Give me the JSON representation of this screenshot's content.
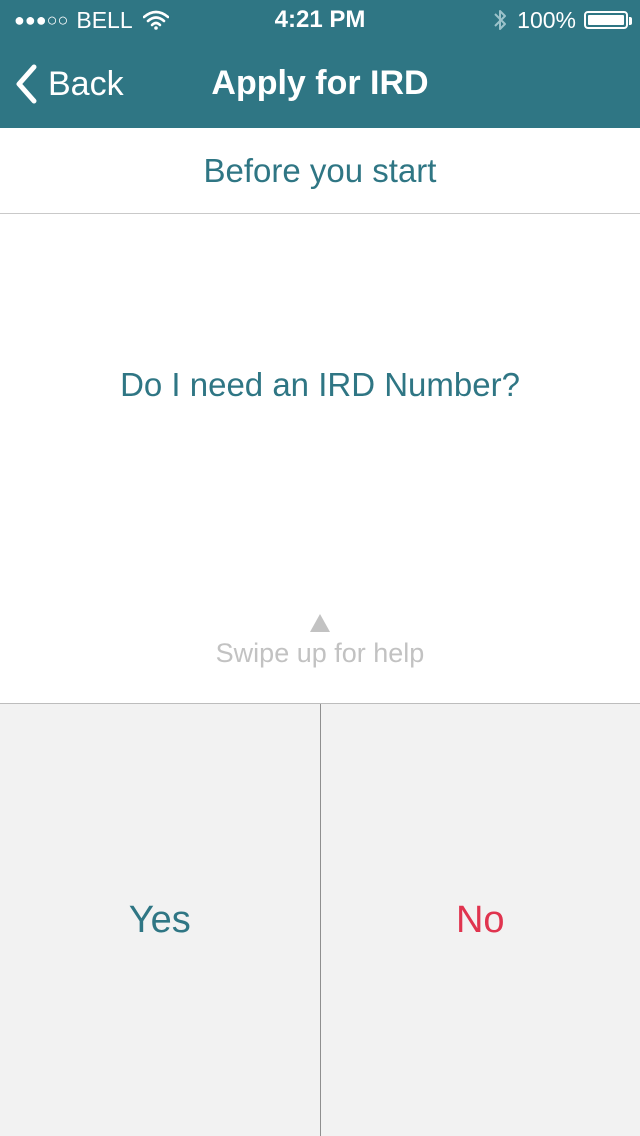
{
  "status_bar": {
    "signal": "●●●○○",
    "carrier": "BELL",
    "time": "4:21 PM",
    "battery_percent": "100%"
  },
  "nav": {
    "back_label": "Back",
    "title": "Apply for IRD"
  },
  "section": {
    "title": "Before you start"
  },
  "question": {
    "text": "Do I need an IRD Number?"
  },
  "hint": {
    "text": "Swipe up for help"
  },
  "answers": {
    "yes_label": "Yes",
    "no_label": "No"
  },
  "colors": {
    "brand": "#2f7684",
    "no": "#e0344f",
    "yes": "#2f7684",
    "hint": "#c2c2c2",
    "answer_background": "#f2f2f2"
  }
}
